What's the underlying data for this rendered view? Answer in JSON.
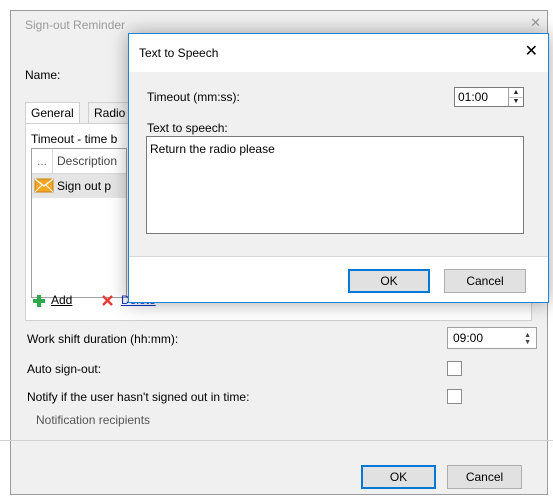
{
  "parent": {
    "title": "Sign-out Reminder",
    "close_glyph": "✕",
    "name_label": "Name:",
    "tabs": [
      {
        "label": "General"
      },
      {
        "label": "Radio"
      }
    ],
    "timeout_section_label": "Timeout - time b",
    "grid": {
      "header_dots": "...",
      "header_description": "Description",
      "rows": [
        {
          "icon": "envelope-icon",
          "text": "Sign out p"
        }
      ]
    },
    "add_label": "Add",
    "delete_label": "Delete",
    "work_shift_label": "Work shift duration (hh:mm):",
    "work_shift_value": "09:00",
    "auto_signout_label": "Auto sign-out:",
    "notify_label": "Notify if the user hasn't signed out in time:",
    "notification_recipients_label": "Notification recipients",
    "ok_label": "OK",
    "cancel_label": "Cancel"
  },
  "dialog": {
    "title": "Text to Speech",
    "close_glyph": "✕",
    "timeout_label": "Timeout (mm:ss):",
    "timeout_value": "01:00",
    "tts_label": "Text to speech:",
    "tts_value": "Return the radio please",
    "ok_label": "OK",
    "cancel_label": "Cancel"
  },
  "colors": {
    "accent": "#0078d7",
    "add_green": "#2ea84a",
    "delete_red": "#e53935",
    "envelope_orange": "#f5a623"
  }
}
